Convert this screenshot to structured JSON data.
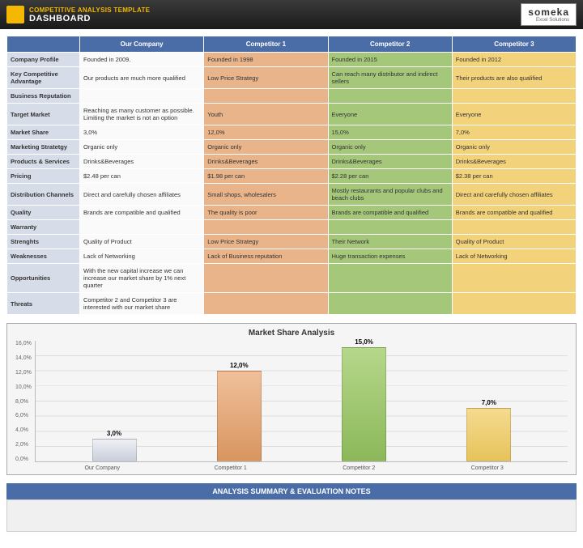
{
  "header": {
    "title": "COMPETITIVE ANALYSIS TEMPLATE",
    "subtitle": "DASHBOARD",
    "brand_name": "someka",
    "brand_sub": "Excel Solutions"
  },
  "columns": [
    "",
    "Our Company",
    "Competitor 1",
    "Competitor 2",
    "Competitor 3"
  ],
  "rows": [
    {
      "label": "Company Profile",
      "c": [
        "Founded in 2009.",
        "Founded in 1998",
        "Founded in 2015",
        "Founded in 2012"
      ]
    },
    {
      "label": "Key Competitive Advantage",
      "c": [
        "Our products are much more qualified",
        "Low Price Strategy",
        "Can reach many distributor and indirect sellers",
        "Their products are also qualified"
      ]
    },
    {
      "label": "Business Reputation",
      "c": [
        "",
        "",
        "",
        ""
      ]
    },
    {
      "label": "Target Market",
      "c": [
        "Reaching as many customer as possible. Limiting the market is not an option",
        "Youth",
        "Everyone",
        "Everyone"
      ]
    },
    {
      "label": "Market Share",
      "c": [
        "3,0%",
        "12,0%",
        "15,0%",
        "7,0%"
      ]
    },
    {
      "label": "Marketing Stratetgy",
      "c": [
        "Organic only",
        "Organic only",
        "Organic only",
        "Organic only"
      ]
    },
    {
      "label": "Products & Services",
      "c": [
        "Drinks&Beverages",
        "Drinks&Beverages",
        "Drinks&Beverages",
        "Drinks&Beverages"
      ]
    },
    {
      "label": "Pricing",
      "c": [
        "$2.48 per can",
        "$1.98 per can",
        "$2.28 per can",
        "$2.38 per can"
      ]
    },
    {
      "label": "Distribution Channels",
      "c": [
        "Direct and carefully chosen affiliates",
        "Small shops, wholesalers",
        "Mostly restaurants and popular clubs and beach clubs",
        "Direct and carefully chosen affiliates"
      ]
    },
    {
      "label": "Quality",
      "c": [
        "Brands are compatible and qualified",
        "The quality is poor",
        "Brands are compatible and qualified",
        "Brands are compatible and qualified"
      ]
    },
    {
      "label": "Warranty",
      "c": [
        "",
        "",
        "",
        ""
      ]
    },
    {
      "label": "Strenghts",
      "c": [
        "Quality of Product",
        "Low Price Strategy",
        "Their Network",
        "Quality of Product"
      ]
    },
    {
      "label": "Weaknesses",
      "c": [
        "Lack of Networking",
        "Lack of  Business reputation",
        "Huge transaction expenses",
        "Lack of Networking"
      ]
    },
    {
      "label": "Opportunities",
      "c": [
        "With the new capital increase we can increase our market share by 1% next quarter",
        "",
        "",
        ""
      ]
    },
    {
      "label": "Threats",
      "c": [
        "Competitor 2 and Competitor 3 are interested with our market share",
        "",
        "",
        ""
      ]
    }
  ],
  "section_title": "ANALYSIS SUMMARY & EVALUATION NOTES",
  "chart_data": {
    "type": "bar",
    "title": "Market Share Analysis",
    "categories": [
      "Our Company",
      "Competitor 1",
      "Competitor 2",
      "Competitor 3"
    ],
    "values": [
      3.0,
      12.0,
      15.0,
      7.0
    ],
    "value_labels": [
      "3,0%",
      "12,0%",
      "15,0%",
      "7,0%"
    ],
    "ylim": [
      0,
      16
    ],
    "yticks": [
      "0,0%",
      "2,0%",
      "4,0%",
      "6,0%",
      "8,0%",
      "10,0%",
      "12,0%",
      "14,0%",
      "16,0%"
    ]
  }
}
